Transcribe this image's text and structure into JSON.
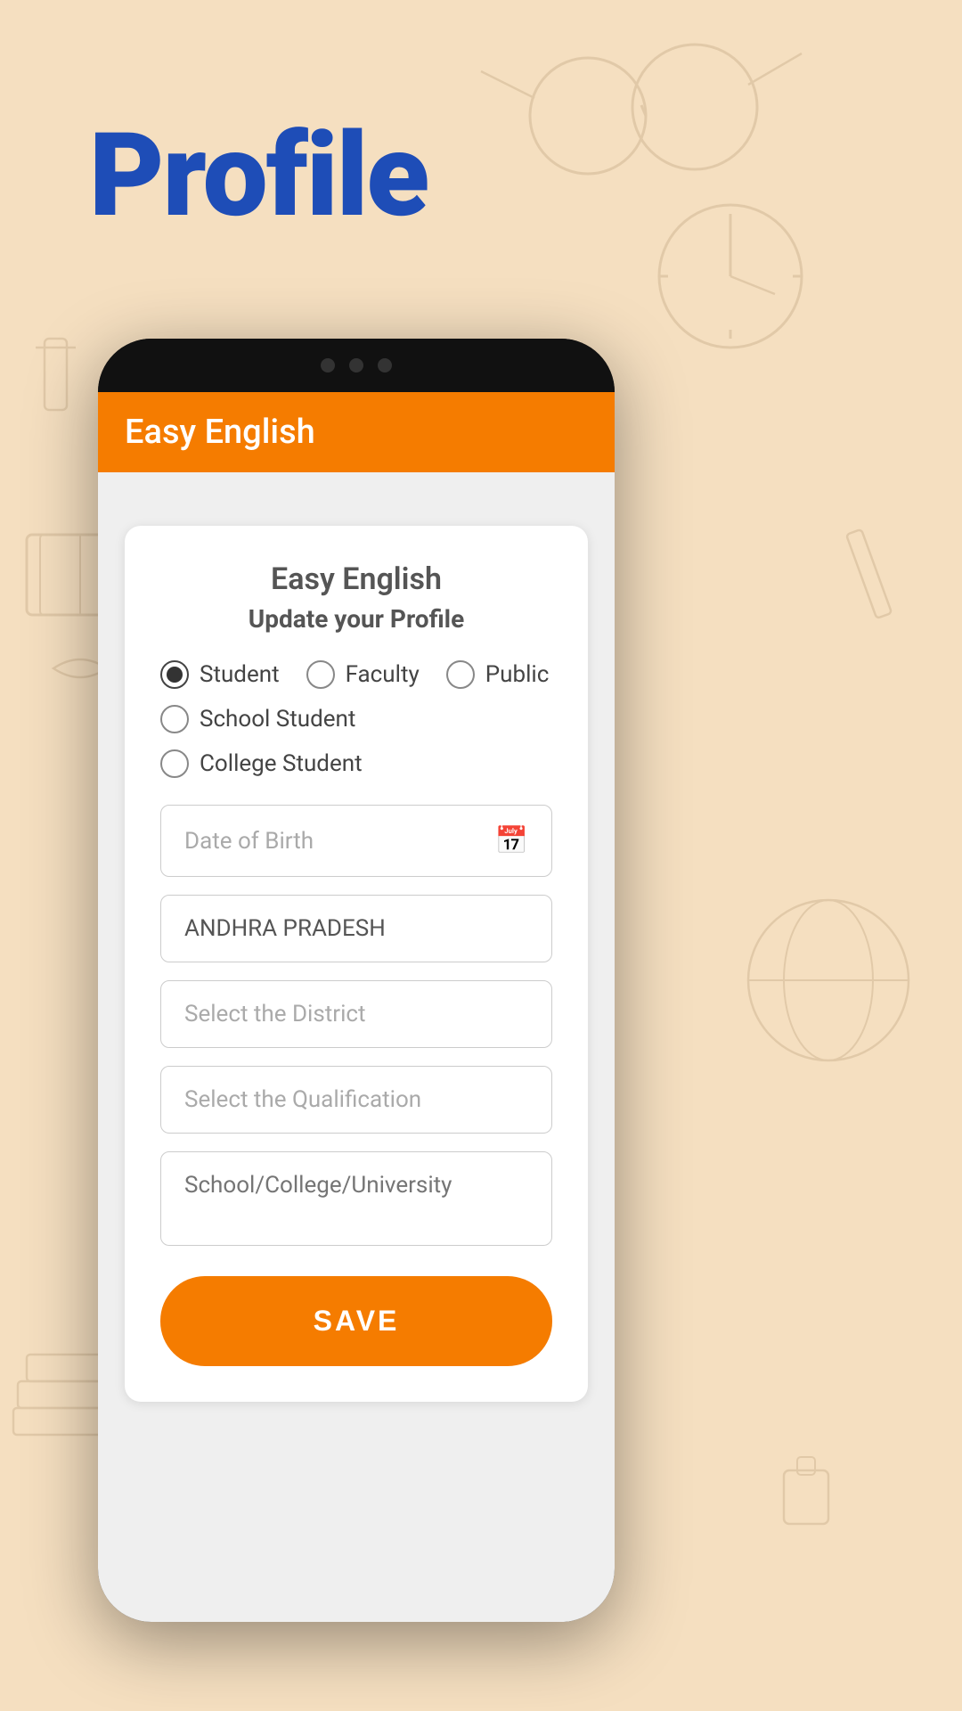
{
  "page": {
    "background_color": "#f5dfc0",
    "title": "Profile"
  },
  "app_bar": {
    "title": "Easy English",
    "background_color": "#f57c00"
  },
  "card": {
    "title": "Easy English",
    "subtitle": "Update your Profile"
  },
  "radio_options": [
    {
      "id": "student",
      "label": "Student",
      "selected": true
    },
    {
      "id": "faculty",
      "label": "Faculty",
      "selected": false
    },
    {
      "id": "public",
      "label": "Public",
      "selected": false
    },
    {
      "id": "school_student",
      "label": "School Student",
      "selected": false
    },
    {
      "id": "college_student",
      "label": "College Student",
      "selected": false
    }
  ],
  "fields": {
    "dob": {
      "placeholder": "Date of Birth",
      "value": "",
      "has_icon": true
    },
    "state": {
      "value": "ANDHRA PRADESH"
    },
    "district": {
      "placeholder": "Select the District",
      "value": ""
    },
    "qualification": {
      "placeholder": "Select the Qualification",
      "value": ""
    },
    "institution": {
      "placeholder": "School/College/University",
      "value": ""
    }
  },
  "save_button": {
    "label": "SAVE"
  }
}
